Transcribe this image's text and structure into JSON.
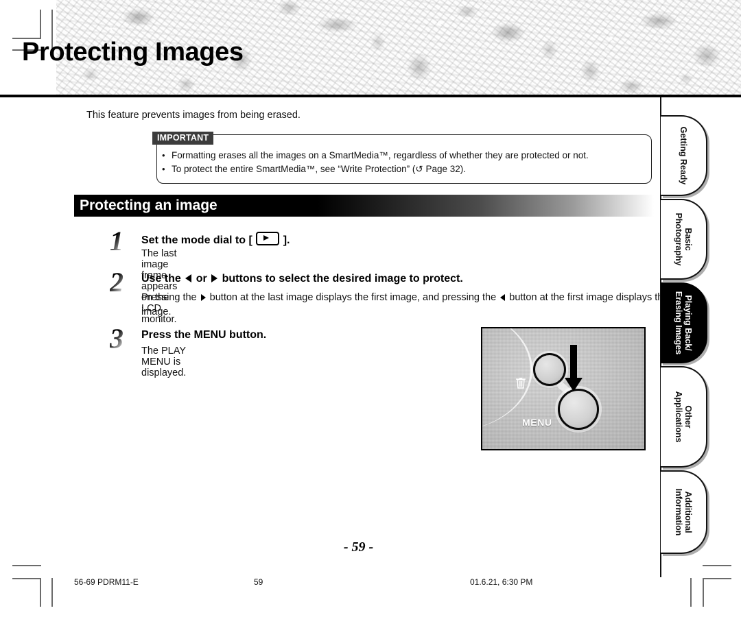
{
  "page": {
    "title": "Protecting Images",
    "intro": "This feature prevents images from being erased.",
    "page_number_display": "- 59 -"
  },
  "important": {
    "label": "IMPORTANT",
    "bullet": "•",
    "items": [
      "Formatting erases all the images on a SmartMedia™, regardless of whether they are protected or not.",
      "To protect the entire SmartMedia™, see “Write Protection” (↺ Page 32)."
    ]
  },
  "section": {
    "title": "Protecting an image"
  },
  "steps": [
    {
      "number": "1",
      "head_before": "Set the mode dial to [",
      "head_after": "].",
      "body": "The last image frame appears on the LCD monitor."
    },
    {
      "number": "2",
      "head_a": "Use the",
      "head_b": "or",
      "head_c": "buttons to select the desired image to protect.",
      "body_a": "Pressing the",
      "body_b": "button at the last image displays the first image, and pressing the",
      "body_c": "button at the first image displays the last image."
    },
    {
      "number": "3",
      "head": "Press the MENU button.",
      "body": "The PLAY MENU is displayed."
    }
  ],
  "camera_photo": {
    "menu_label": "MENU",
    "trash_glyph": "Ὕ1",
    "caption": ""
  },
  "tabs": [
    {
      "label": "Getting Ready",
      "active": false
    },
    {
      "label": "Basic\nPhotography",
      "active": false
    },
    {
      "label": "Playing Back/\nErasing Images",
      "active": true
    },
    {
      "label": "Other\nApplications",
      "active": false
    },
    {
      "label": "Additional\nInformation",
      "active": false
    }
  ],
  "tab_labels_flat": {
    "t0": "Getting Ready",
    "t1_line1": "Basic",
    "t1_line2": "Photography",
    "t2_line1": "Playing Back/",
    "t2_line2": "Erasing Images",
    "t3_line1": "Other",
    "t3_line2": "Applications",
    "t4_line1": "Additional",
    "t4_line2": "Information"
  },
  "footer": {
    "left": "56-69 PDRM11-E",
    "center": "59",
    "right": "01.6.21, 6:30 PM"
  },
  "colors": {
    "rule": "#000000",
    "important_label_bg": "#3c3c3c",
    "active_tab_bg": "#000000",
    "section_bar_start": "#000000",
    "section_bar_end": "#ffffff"
  }
}
